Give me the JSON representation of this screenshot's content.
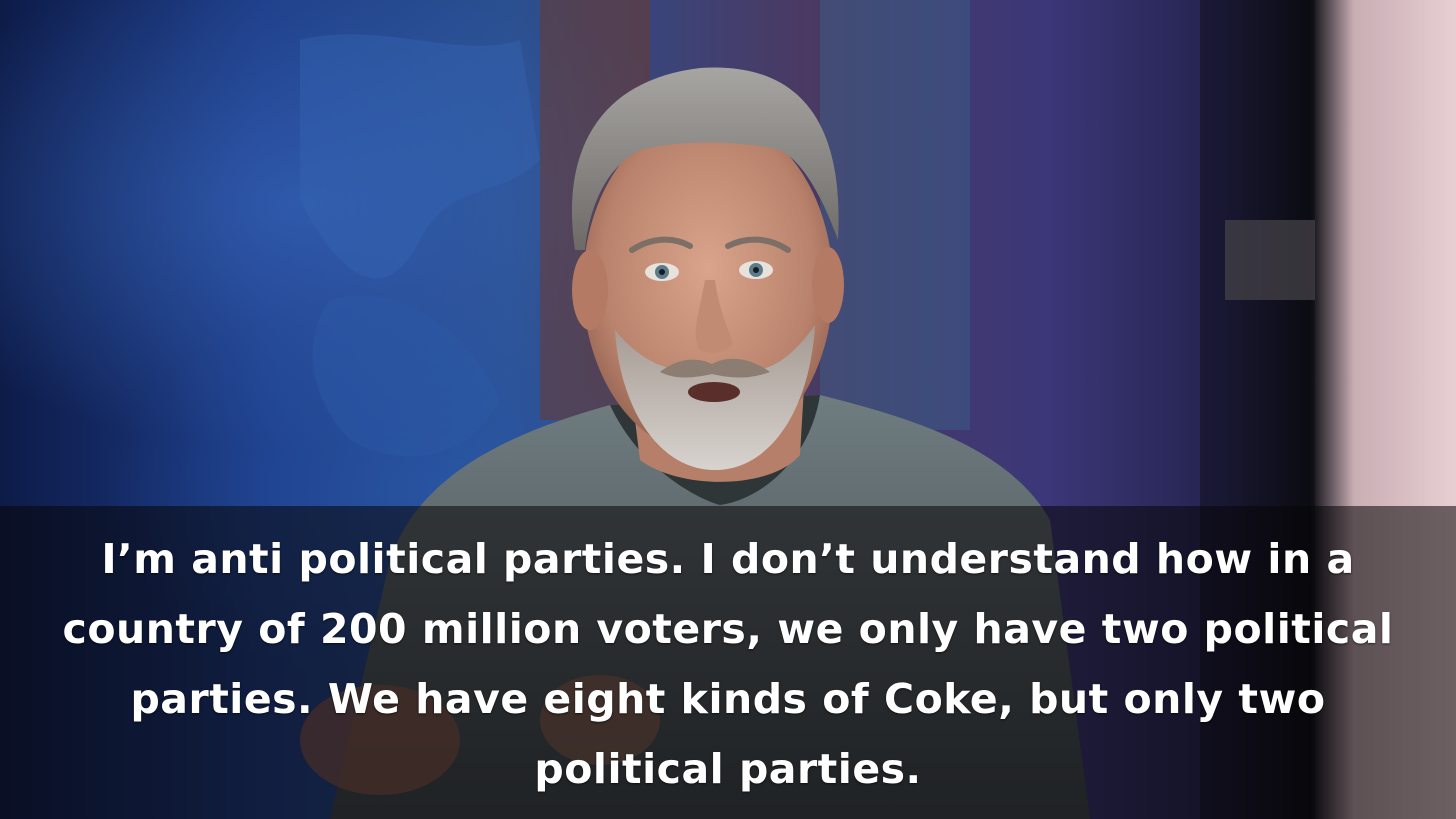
{
  "image": {
    "subject": "speaker-with-caption",
    "colors": {
      "background_blue": "#1f3f86",
      "background_purple": "#3b2f72",
      "shirt_gray": "#5d6a6e",
      "skin": "#c7927a",
      "hair_gray": "#8d8b89",
      "caption_band": "#080608",
      "caption_text": "#ffffff"
    }
  },
  "caption": {
    "text": "I’m anti political parties. I don’t understand how in a country of 200 million voters, we only have two political parties. We have eight kinds of Coke, but only two political parties."
  }
}
